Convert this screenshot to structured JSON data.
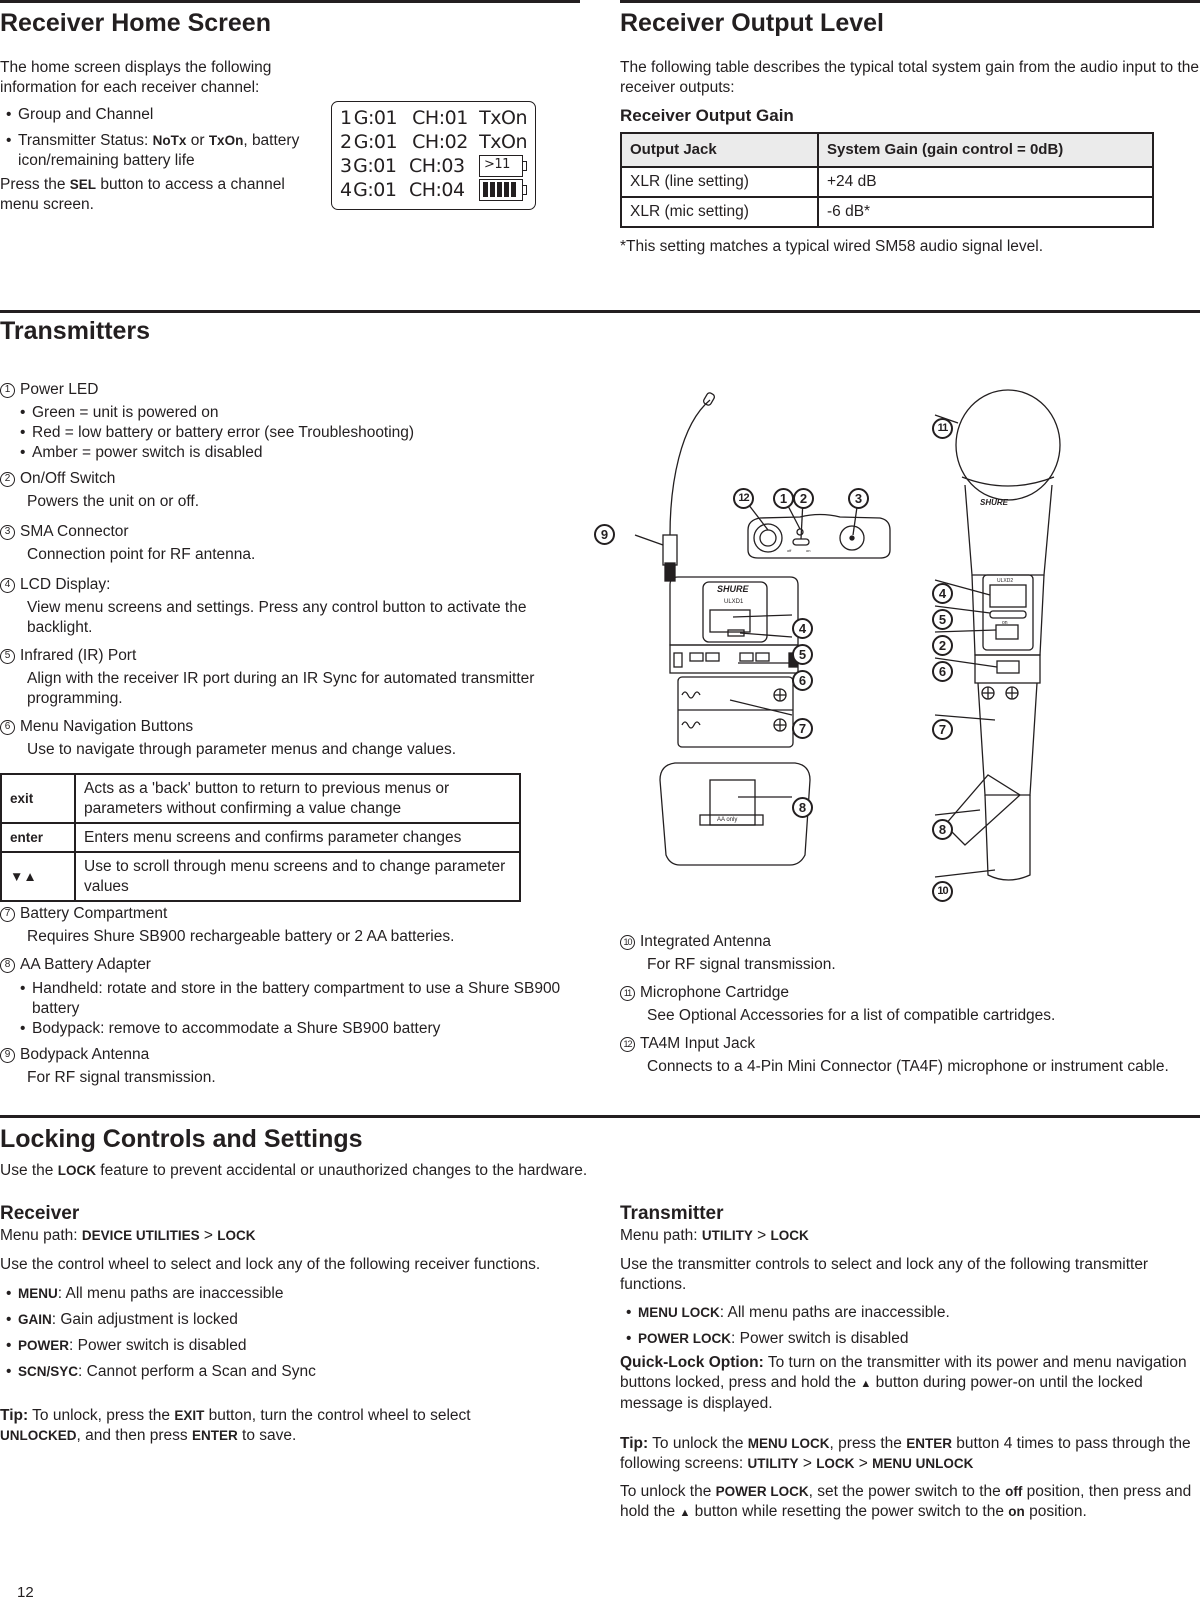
{
  "page_number": "12",
  "receiver_home_screen": {
    "title": "Receiver Home Screen",
    "intro": "The home screen displays the following information for each receiver channel:",
    "bullets": [
      {
        "text": "Group and Channel"
      },
      {
        "pre": "Transmitter Status: ",
        "bold1": "NoTx",
        "mid": " or ",
        "bold2": "TxOn",
        "post": ", battery icon/remaining battery life"
      }
    ],
    "press_pre": "Press the ",
    "press_bold": "SEL",
    "press_post": " button to access a channel menu screen.",
    "lcd": {
      "rows": [
        {
          "ch": "1",
          "group": "G:01",
          "channel": "CH:01",
          "status": "TxOn"
        },
        {
          "ch": "2",
          "group": "G:01",
          "channel": "CH:02",
          "status": "TxOn"
        },
        {
          "ch": "3",
          "group": "G:01",
          "channel": "CH:03",
          "status": ">11"
        },
        {
          "ch": "4",
          "group": "G:01",
          "channel": "CH:04",
          "status": "battery-full"
        }
      ],
      "battery_bars": 5
    }
  },
  "receiver_output_level": {
    "title": "Receiver Output Level",
    "intro": "The following table describes the typical total system gain from the audio input to the receiver outputs:",
    "table_title": "Receiver Output Gain",
    "headers": [
      "Output Jack",
      "System Gain (gain control = 0dB)"
    ],
    "rows": [
      [
        "XLR (line setting)",
        "+24 dB"
      ],
      [
        "XLR (mic setting)",
        "-6 dB*"
      ]
    ],
    "footnote": "*This setting matches a typical wired SM58 audio signal level."
  },
  "transmitters": {
    "title": "Transmitters",
    "items": [
      {
        "num": "1",
        "title": "Power LED",
        "bullets": [
          "Green = unit is powered on",
          "Red = low battery or battery error (see Troubleshooting)",
          "Amber = power switch is disabled"
        ]
      },
      {
        "num": "2",
        "title": "On/Off Switch",
        "desc": "Powers the unit on or off."
      },
      {
        "num": "3",
        "title": "SMA Connector",
        "desc": "Connection point for RF antenna."
      },
      {
        "num": "4",
        "title": "LCD Display:",
        "desc": "View menu screens and settings. Press any control button to activate the backlight."
      },
      {
        "num": "5",
        "title": "Infrared (IR) Port",
        "desc": "Align with the receiver IR port during an IR Sync for automated transmitter programming."
      },
      {
        "num": "6",
        "title": "Menu Navigation Buttons",
        "desc": "Use to navigate through parameter menus and change values."
      },
      {
        "num": "7",
        "title": "Battery Compartment",
        "desc": "Requires Shure SB900 rechargeable battery or 2 AA batteries."
      },
      {
        "num": "8",
        "title": "AA Battery Adapter",
        "bullets": [
          "Handheld: rotate and store in the battery compartment to use a Shure SB900 battery",
          "Bodypack: remove to accommodate a Shure SB900 battery"
        ]
      },
      {
        "num": "9",
        "title": "Bodypack Antenna",
        "desc": "For RF signal transmission."
      },
      {
        "num": "10",
        "title": "Integrated Antenna",
        "desc": "For RF signal transmission."
      },
      {
        "num": "11",
        "title": "Microphone Cartridge",
        "desc": "See Optional Accessories for a list of compatible cartridges."
      },
      {
        "num": "12",
        "title": "TA4M Input Jack",
        "desc": "Connects to a 4-Pin Mini Connector (TA4F) microphone or instrument cable."
      }
    ],
    "nav_table": [
      {
        "key": "exit",
        "desc": "Acts as a 'back' button to return to previous menus or parameters without confirming a value change"
      },
      {
        "key": "enter",
        "desc": "Enters menu screens and confirms parameter changes"
      },
      {
        "key": "▼▲",
        "desc": "Use to scroll through menu screens and to change parameter values"
      }
    ],
    "diagram": {
      "bodypack_brand": "SHURE",
      "bodypack_model": "ULXD1",
      "switch_off_label": "off",
      "switch_on_label": "on",
      "adapter_label": "AA only",
      "handheld_brand": "SHURE",
      "handheld_model": "ULXD2",
      "handheld_on_label": "on"
    }
  },
  "locking": {
    "title": "Locking Controls and Settings",
    "intro_pre": "Use the ",
    "intro_bold": "LOCK",
    "intro_post": " feature to prevent accidental or unauthorized changes to the hardware.",
    "receiver": {
      "title": "Receiver",
      "menu_path_label": "Menu path: ",
      "menu_path_1": "DEVICE UTILITIES",
      "menu_path_sep": " > ",
      "menu_path_2": "LOCK",
      "intro": "Use the control wheel to select and lock any of the following receiver functions.",
      "items": [
        {
          "key": "MENU",
          "desc": ": All menu paths are inaccessible"
        },
        {
          "key": "GAIN",
          "desc": ": Gain adjustment is locked"
        },
        {
          "key": "POWER",
          "desc": ": Power switch is disabled"
        },
        {
          "key": "SCN/SYC",
          "desc": ": Cannot perform a Scan and Sync"
        }
      ],
      "tip_label": "Tip:",
      "tip_1": " To unlock, press the ",
      "tip_b1": "EXIT",
      "tip_2": " button, turn the control wheel to select ",
      "tip_b2": "UNLOCKED",
      "tip_3": ", and then press ",
      "tip_b3": "ENTER",
      "tip_4": " to save."
    },
    "transmitter": {
      "title": "Transmitter",
      "menu_path_label": "Menu path: ",
      "menu_path_1": "UTILITY",
      "menu_path_sep": " > ",
      "menu_path_2": "LOCK",
      "intro": "Use the transmitter controls to select and lock any of the following transmitter functions.",
      "items": [
        {
          "key": "MENU LOCK",
          "desc": ": All menu paths are inaccessible."
        },
        {
          "key": "POWER LOCK",
          "desc": ": Power switch is disabled"
        }
      ],
      "quick_label": "Quick-Lock Option:",
      "quick_text_1": " To turn on the transmitter with its power and menu navigation buttons locked, press and hold the ",
      "quick_glyph": "▲",
      "quick_text_2": " button during power-on until the locked message is displayed.",
      "tip_label": "Tip:",
      "tip_1": " To unlock the ",
      "tip_b1": "MENU LOCK",
      "tip_2": ", press the ",
      "tip_b2": "ENTER",
      "tip_3": " button 4 times to pass through the following screens: ",
      "tip_b3": "UTILITY",
      "tip_sep1": " > ",
      "tip_b4": "LOCK",
      "tip_sep2": " > ",
      "tip_b5": "MENU UNLOCK",
      "power_1": "To unlock the ",
      "power_b1": "POWER LOCK",
      "power_2": ", set the power switch to the ",
      "power_b2": "off",
      "power_3": " position, then press and hold the ",
      "power_glyph": "▲",
      "power_4": " button while resetting the power switch to the ",
      "power_b3": "on",
      "power_5": " position."
    }
  }
}
